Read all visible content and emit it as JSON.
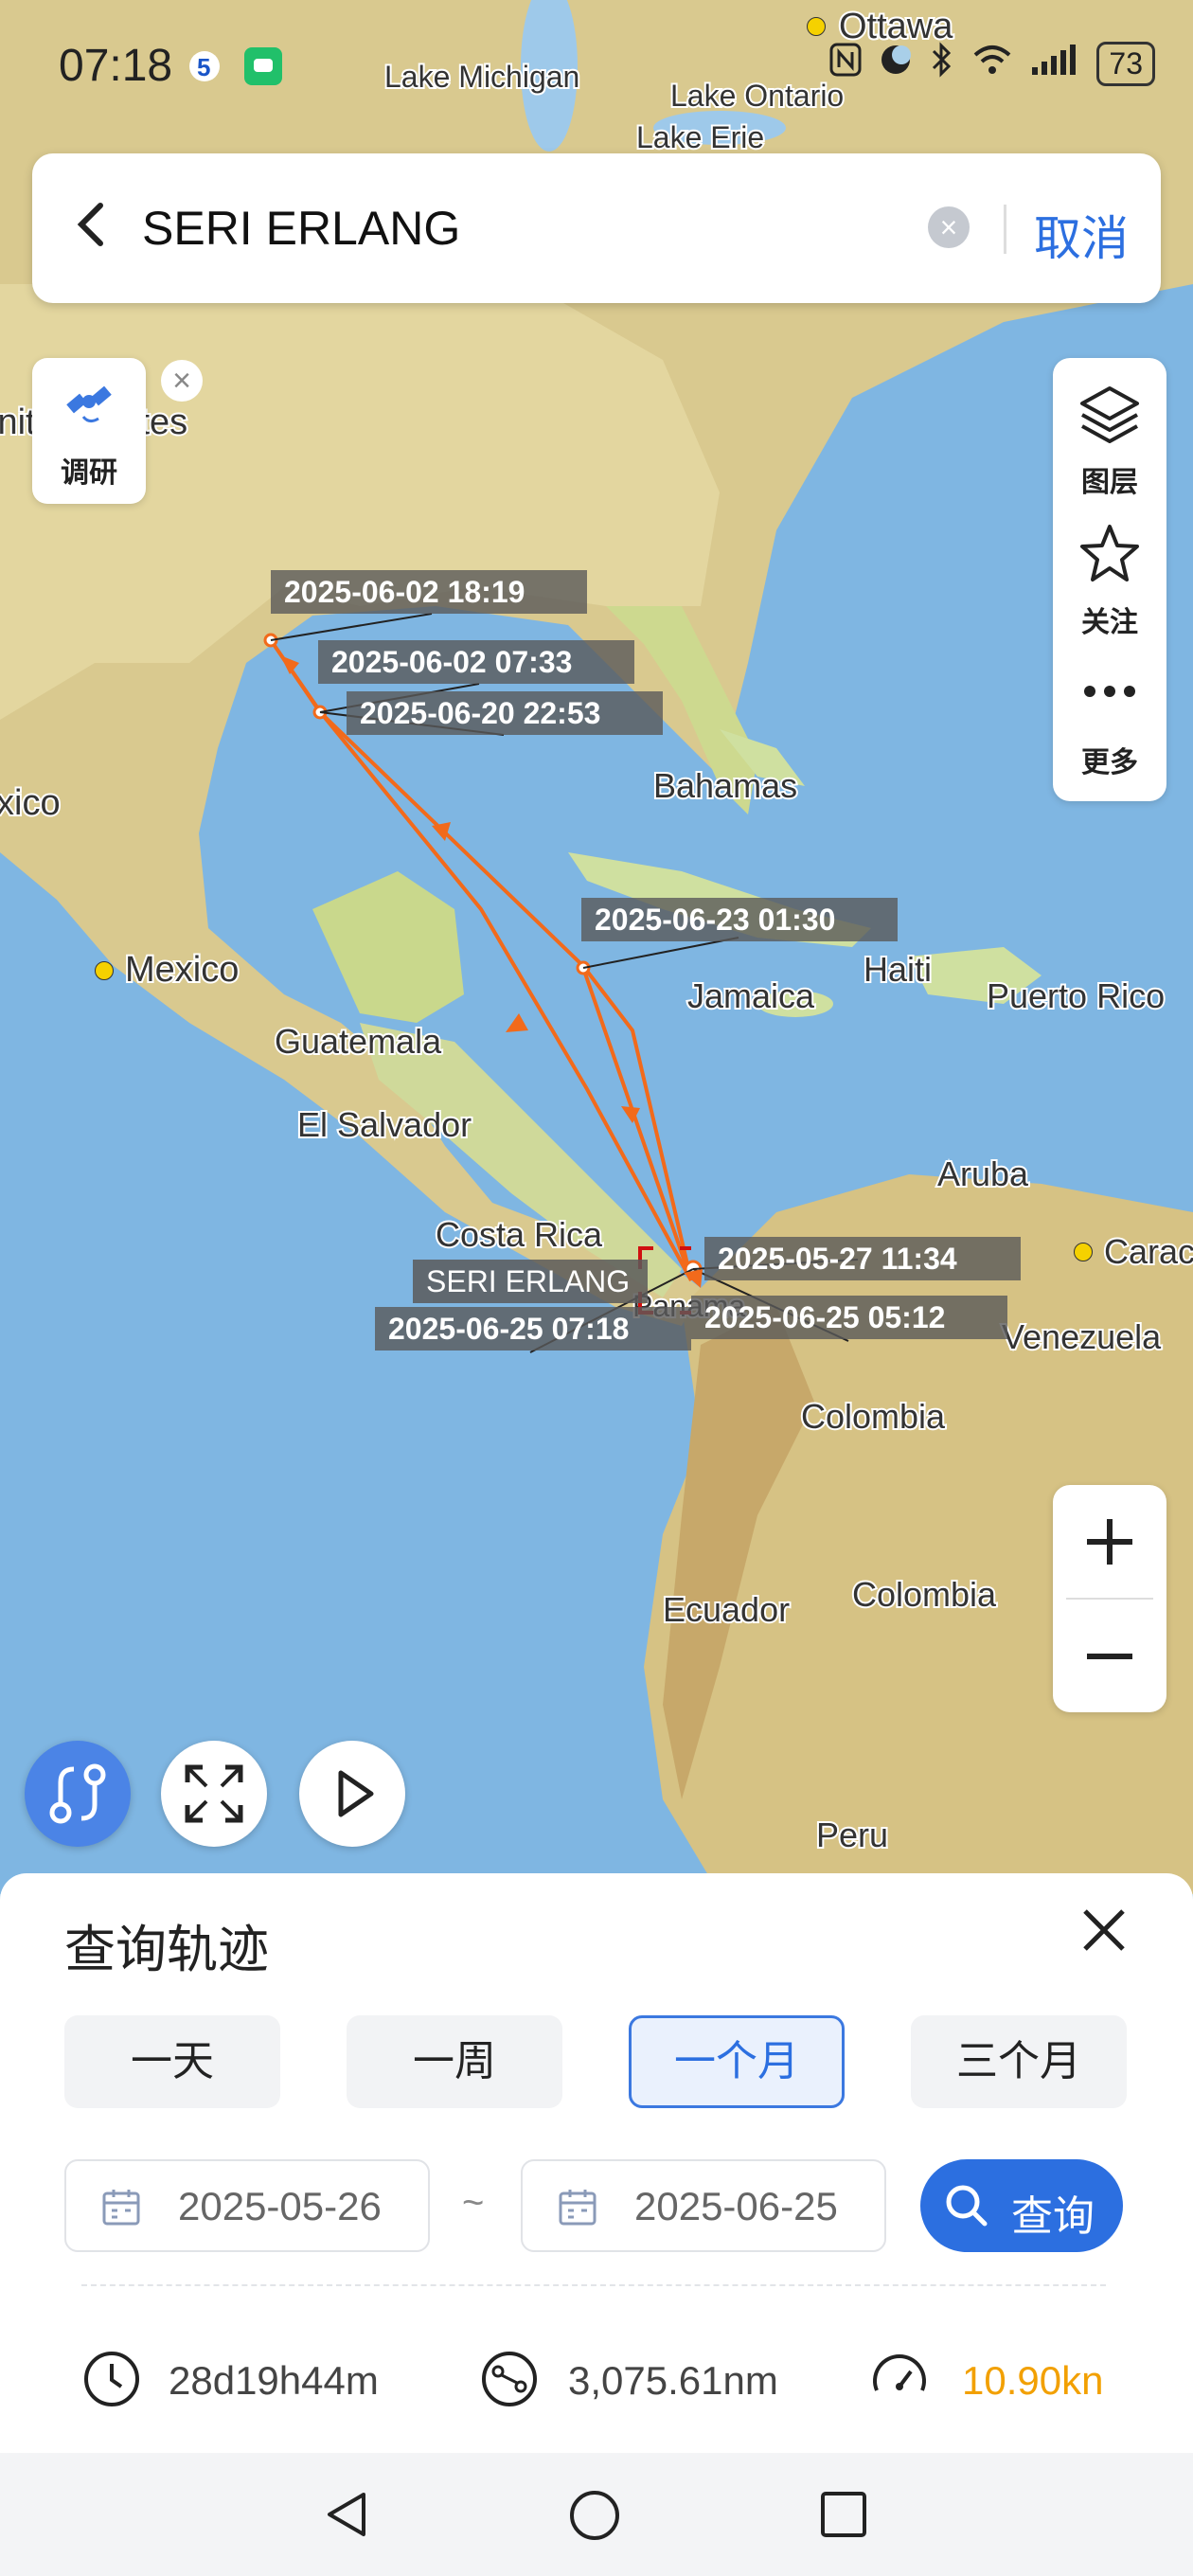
{
  "status_bar": {
    "time": "07:18",
    "battery": "73"
  },
  "search": {
    "title": "SERI ERLANG",
    "cancel_label": "取消"
  },
  "left_tool": {
    "label": "调研"
  },
  "right_toolbar": {
    "layers_label": "图层",
    "follow_label": "关注",
    "more_label": "更多"
  },
  "map": {
    "place_labels": [
      "Ottawa",
      "Lake Michigan",
      "Lake Ontario",
      "Lake Erie",
      "United States",
      "xico",
      "Mexico",
      "Bahamas",
      "Guatemala",
      "El Salvador",
      "Costa Rica",
      "Jamaica",
      "Haiti",
      "Puerto Rico",
      "Aruba",
      "Caracas",
      "Venezuela",
      "Colombia",
      "Ecuador",
      "Colombia",
      "Peru",
      "Panama"
    ],
    "vessel_label": "SERI ERLANG",
    "track_labels": [
      "2025-06-02 18:19",
      "2025-06-02 07:33",
      "2025-06-20 22:53",
      "2025-06-23 01:30",
      "2025-05-27 11:34",
      "2025-06-25 05:12",
      "2025-06-25 07:18"
    ],
    "track_color": "#f26a1b"
  },
  "panel": {
    "title": "查询轨迹",
    "periods": [
      "一天",
      "一周",
      "一个月",
      "三个月"
    ],
    "active_period": "一个月",
    "start_date": "2025-05-26",
    "separator": "~",
    "end_date": "2025-06-25",
    "query_label": "查询",
    "duration": "28d19h44m",
    "distance": "3,075.61nm",
    "speed": "10.90kn",
    "speed_color": "#f2a000"
  }
}
